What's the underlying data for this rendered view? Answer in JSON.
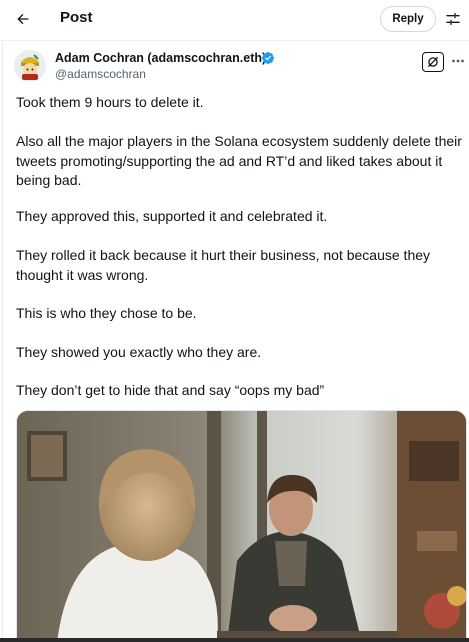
{
  "header": {
    "title": "Post",
    "reply_label": "Reply",
    "back_icon": "arrow-left-icon",
    "adjust_icon": "sliders-icon"
  },
  "author": {
    "name": "Adam Cochran (adamscochran.eth)",
    "handle": "@adamscochran",
    "verified": true,
    "verified_color": "#1d9bf0"
  },
  "post": {
    "paragraphs": [
      "Took them 9 hours to delete it.",
      "Also all the major players in the Solana ecosystem suddenly delete their tweets promoting/supporting the ad and RT’d and liked takes about it being bad.",
      "They approved this, supported it and celebrated it.",
      "They rolled it back because it hurt their business, not because they thought it was wrong.",
      "This is who they chose to be.",
      "They showed you exactly who they are.",
      "They don’t get to hide that and say “oops my bad”"
    ]
  },
  "colors": {
    "text": "#0f1419",
    "secondary_text": "#536471",
    "border": "#cfd9de"
  }
}
